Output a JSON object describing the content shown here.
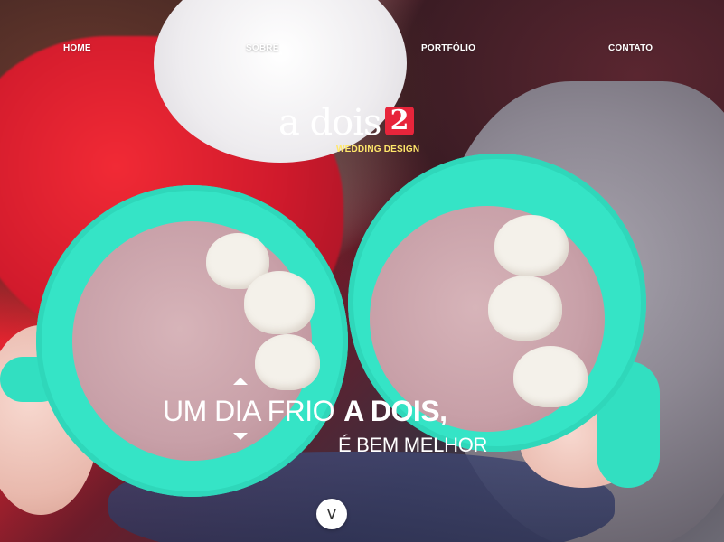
{
  "nav": {
    "items": [
      {
        "label": "HOME"
      },
      {
        "label": "SOBRE"
      },
      {
        "label": "PORTFÓLIO"
      },
      {
        "label": "CONTATO"
      }
    ]
  },
  "logo": {
    "text": "a dois",
    "mark": "2",
    "subtitle": "WEDDING DESIGN"
  },
  "hero": {
    "headline_light": "UM DIA FRIO",
    "headline_bold": "A DOIS,",
    "subline": "É BEM MELHOR",
    "scroll_icon": "v"
  },
  "colors": {
    "accent": "#e7253b",
    "logo_subtitle": "#ffe76a",
    "cup": "#35e4c6",
    "text": "#ffffff"
  }
}
